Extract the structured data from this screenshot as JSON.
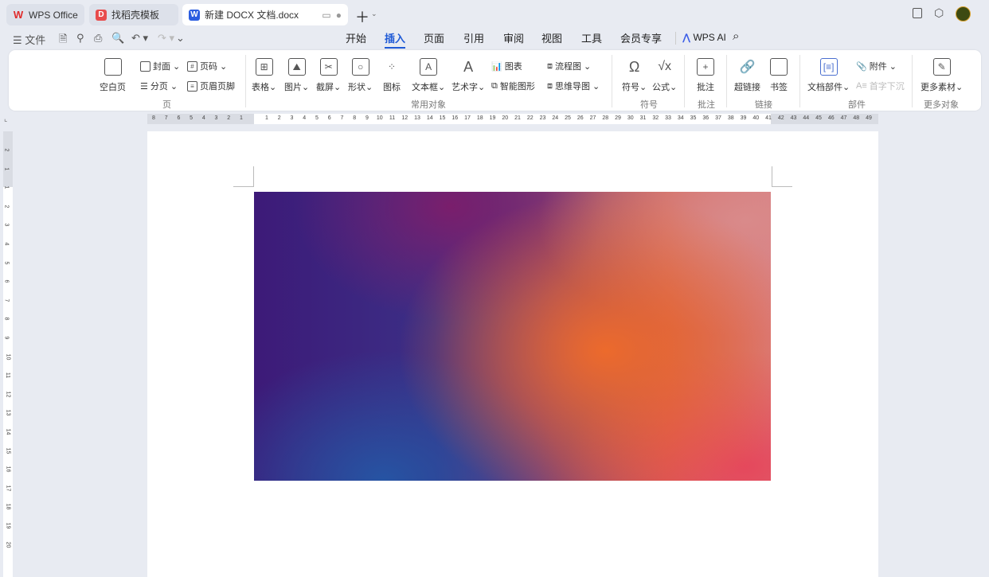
{
  "tabs": [
    {
      "label": "WPS Office"
    },
    {
      "label": "找稻壳模板"
    },
    {
      "label": "新建 DOCX 文档.docx"
    }
  ],
  "menu": {
    "file": "文件",
    "items": [
      "开始",
      "插入",
      "页面",
      "引用",
      "审阅",
      "视图",
      "工具",
      "会员专享"
    ],
    "active": "插入",
    "ai": "WPS AI"
  },
  "ribbon": {
    "page": {
      "blank": "空白页",
      "cover": "封面",
      "pagenum": "页码",
      "break": "分页",
      "header_footer": "页眉页脚",
      "group": "页"
    },
    "common": {
      "table": "表格",
      "picture": "图片",
      "screenshot": "截屏",
      "shape": "形状",
      "icon": "图标",
      "textbox": "文本框",
      "wordart": "艺术字",
      "chart": "图表",
      "smart": "智能图形",
      "flow": "流程图",
      "mind": "思维导图",
      "group": "常用对象"
    },
    "symbol": {
      "symbol": "符号",
      "formula": "公式",
      "group": "符号"
    },
    "comment": {
      "comment": "批注",
      "group": "批注"
    },
    "link": {
      "hyperlink": "超链接",
      "bookmark": "书签",
      "group": "链接"
    },
    "parts": {
      "docparts": "文档部件",
      "attach": "附件",
      "dropcap": "首字下沉",
      "group": "部件"
    },
    "more": {
      "material": "更多素材",
      "group": "更多对象"
    }
  },
  "ruler": {
    "left": [
      "8",
      "7",
      "6",
      "5",
      "4",
      "3",
      "2",
      "1"
    ],
    "right": [
      "1",
      "2",
      "3",
      "4",
      "5",
      "6",
      "7",
      "8",
      "9",
      "10",
      "11",
      "12",
      "13",
      "14",
      "15",
      "16",
      "17",
      "18",
      "19",
      "20",
      "21",
      "22",
      "23",
      "24",
      "25",
      "26",
      "27",
      "28",
      "29",
      "30",
      "31",
      "32",
      "33",
      "34",
      "35",
      "36",
      "37",
      "38",
      "39",
      "40",
      "41",
      "42",
      "43",
      "44",
      "45",
      "46",
      "47",
      "48",
      "49"
    ]
  },
  "vruler": [
    "2",
    "1",
    "1",
    "2",
    "3",
    "4",
    "5",
    "6",
    "7",
    "8",
    "9",
    "10",
    "11",
    "12",
    "13",
    "14",
    "15",
    "16",
    "17",
    "18",
    "19",
    "20"
  ]
}
